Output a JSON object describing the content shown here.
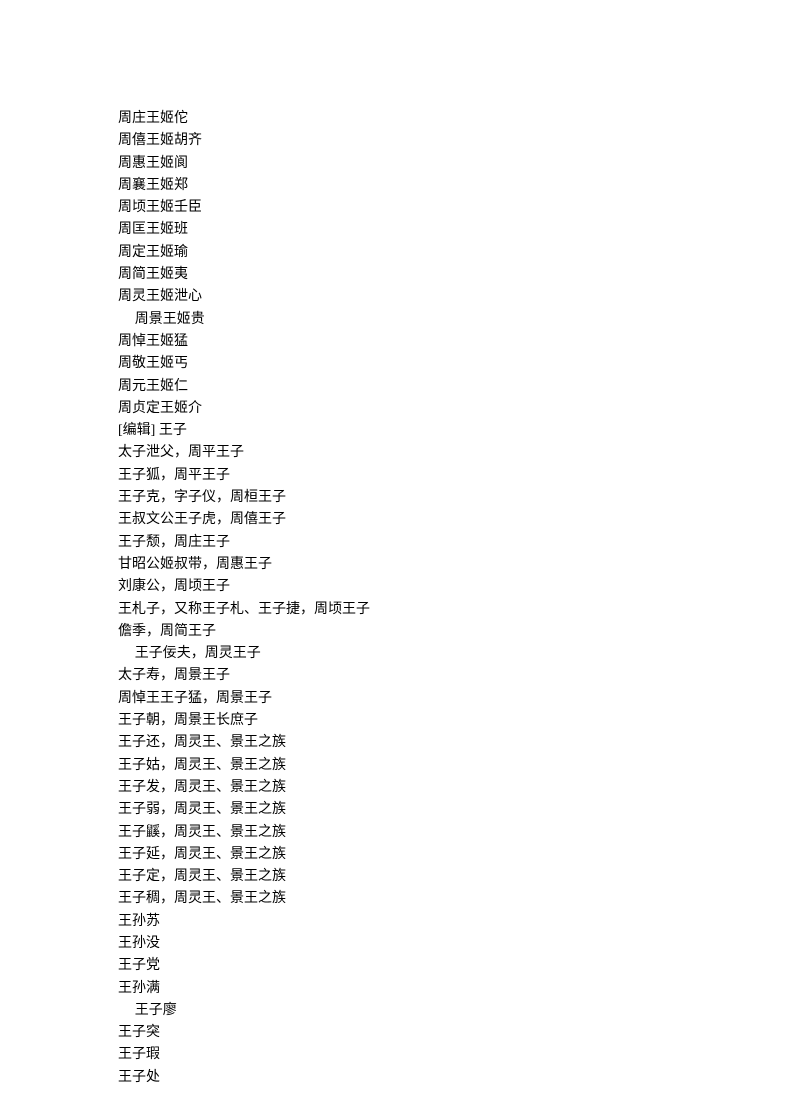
{
  "lines": [
    {
      "text": "周庄王姬佗",
      "indent": false
    },
    {
      "text": "周僖王姬胡齐",
      "indent": false
    },
    {
      "text": "周惠王姬阆",
      "indent": false
    },
    {
      "text": "周襄王姬郑",
      "indent": false
    },
    {
      "text": "周顷王姬壬臣",
      "indent": false
    },
    {
      "text": "周匡王姬班",
      "indent": false
    },
    {
      "text": "周定王姬瑜",
      "indent": false
    },
    {
      "text": "周简王姬夷",
      "indent": false
    },
    {
      "text": "周灵王姬泄心",
      "indent": false
    },
    {
      "text": "周景王姬贵",
      "indent": true
    },
    {
      "text": "周悼王姬猛",
      "indent": false
    },
    {
      "text": "周敬王姬丐",
      "indent": false
    },
    {
      "text": "周元王姬仁",
      "indent": false
    },
    {
      "text": "周贞定王姬介",
      "indent": false
    },
    {
      "text": "[编辑] 王子",
      "indent": false
    },
    {
      "text": "太子泄父，周平王子",
      "indent": false
    },
    {
      "text": "王子狐，周平王子",
      "indent": false
    },
    {
      "text": "王子克，字子仪，周桓王子",
      "indent": false
    },
    {
      "text": "王叔文公王子虎，周僖王子",
      "indent": false
    },
    {
      "text": "王子颓，周庄王子",
      "indent": false
    },
    {
      "text": "甘昭公姬叔带，周惠王子",
      "indent": false
    },
    {
      "text": "刘康公，周顷王子",
      "indent": false
    },
    {
      "text": "王札子，又称王子札、王子捷，周顷王子",
      "indent": false
    },
    {
      "text": "儋季，周简王子",
      "indent": false
    },
    {
      "text": "王子佞夫，周灵王子",
      "indent": true
    },
    {
      "text": "太子寿，周景王子",
      "indent": false
    },
    {
      "text": "周悼王王子猛，周景王子",
      "indent": false
    },
    {
      "text": "王子朝，周景王长庶子",
      "indent": false
    },
    {
      "text": "王子还，周灵王、景王之族",
      "indent": false
    },
    {
      "text": "王子姑，周灵王、景王之族",
      "indent": false
    },
    {
      "text": "王子发，周灵王、景王之族",
      "indent": false
    },
    {
      "text": "王子弱，周灵王、景王之族",
      "indent": false
    },
    {
      "text": "王子鼷，周灵王、景王之族",
      "indent": false
    },
    {
      "text": "王子延，周灵王、景王之族",
      "indent": false
    },
    {
      "text": "王子定，周灵王、景王之族",
      "indent": false
    },
    {
      "text": "王子稠，周灵王、景王之族",
      "indent": false
    },
    {
      "text": "王孙苏",
      "indent": false
    },
    {
      "text": "王孙没",
      "indent": false
    },
    {
      "text": "王子党",
      "indent": false
    },
    {
      "text": "王孙满",
      "indent": false
    },
    {
      "text": "王子廖",
      "indent": true
    },
    {
      "text": "王子突",
      "indent": false
    },
    {
      "text": "王子瑕",
      "indent": false
    },
    {
      "text": "王子处",
      "indent": false
    }
  ]
}
